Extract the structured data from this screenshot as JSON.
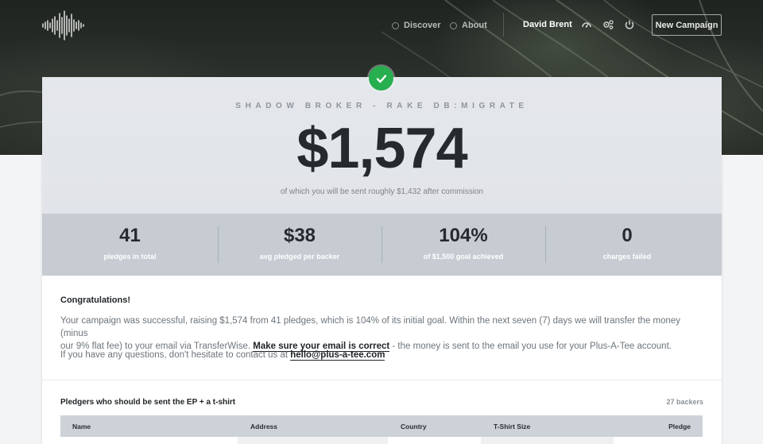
{
  "nav": {
    "discover_label": "Discover",
    "about_label": "About",
    "user_name": "David Brent",
    "new_campaign_label": "New Campaign"
  },
  "campaign": {
    "title": "SHADOW BROKER - RAKE DB:MIGRATE",
    "amount": "$1,574",
    "amount_sub": "of which you will be sent roughly $1,432 after commission"
  },
  "stats": [
    {
      "value": "41",
      "label": "pledges in total"
    },
    {
      "value": "$38",
      "label": "avg pledged per backer"
    },
    {
      "value": "104%",
      "label": "of $1,500 goal achieved"
    },
    {
      "value": "0",
      "label": "charges failed"
    }
  ],
  "message": {
    "heading": "Congratulations!",
    "p1_a": "Your campaign was successful, raising $1,574 from 41 pledges, which is 104% of its initial goal. Within the next seven (7) days we will transfer the money (minus",
    "p1_b": "our 9% flat fee) to your email via TransferWise.",
    "p1_emph": "Make sure your email is correct",
    "p1_c": "- the money is sent to the email you use for your Plus-A-Tee account.",
    "p2_a": "If you have any questions, don't hesitate to contact us at",
    "p2_email": "hello@plus-a-tee.com"
  },
  "pledgers": {
    "title": "Pledgers who should be sent the EP + a t-shirt",
    "count": "27 backers",
    "columns": [
      "Name",
      "Address",
      "Country",
      "T-Shirt Size",
      "Pledge"
    ]
  },
  "colors": {
    "accent_green": "#27ae4f",
    "stats_band": "#c6ccd2",
    "header_band": "#e3e6ea"
  }
}
